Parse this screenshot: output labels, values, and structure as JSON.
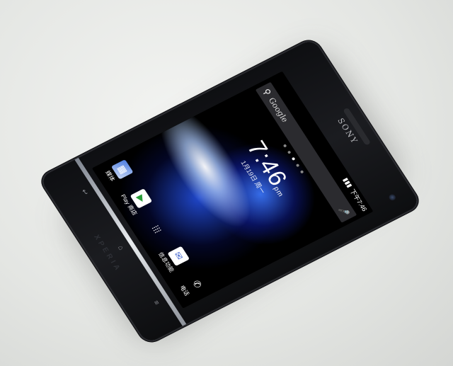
{
  "device": {
    "brand": "SONY",
    "model_logo": "XPERIA"
  },
  "statusbar": {
    "time": "下午7:46"
  },
  "search": {
    "label": "Google",
    "search_icon": "search-icon",
    "mic_icon": "mic-icon"
  },
  "clock": {
    "time": "7:46",
    "ampm": "pm",
    "date": "1月19日 周一"
  },
  "dock": [
    {
      "label": "媒体",
      "icon": "folder-icon"
    },
    {
      "label": "Play 商店",
      "icon": "play-store-icon"
    },
    {
      "label": "",
      "icon": "apps-grid-icon"
    },
    {
      "label": "信息功能",
      "icon": "messaging-icon"
    },
    {
      "label": "电话",
      "icon": "phone-icon"
    }
  ],
  "colors": {
    "phone_body": "#121317",
    "screen_glow": "#2d5bff",
    "background": "#e4e6e3"
  }
}
